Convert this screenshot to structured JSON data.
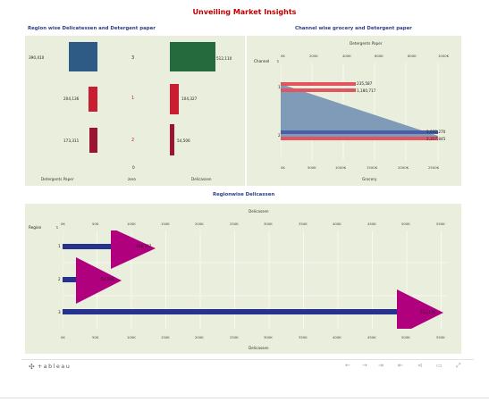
{
  "dashboard": {
    "title": "Unveiling Market Insights"
  },
  "region_chart": {
    "title": "Region wise Delicatessen and Detergent paper",
    "col_headers": [
      "Detergents Paper",
      "zero",
      "Delicassen"
    ],
    "rows": [
      {
        "region": "3",
        "detergents": "390,410",
        "delicassen": "512,110"
      },
      {
        "region": "1",
        "detergents": "204,136",
        "delicassen": "104,327"
      },
      {
        "region": "2",
        "detergents": "173,311",
        "delicassen": "54,506"
      }
    ],
    "zero_value": "0",
    "colors": {
      "blue": "#2e5a86",
      "green": "#246a3c",
      "red": "#c91d31",
      "darkred": "#9b1432",
      "region_red": "#d0202a"
    }
  },
  "channel_chart": {
    "title": "Channel wise grocery and Detergent paper",
    "top_axis_title": "Detergents Paper",
    "top_ticks": [
      "0K",
      "200K",
      "400K",
      "600K",
      "800K",
      "1000K"
    ],
    "bottom_axis_title": "Grocery",
    "bottom_ticks": [
      "0K",
      "500K",
      "1000K",
      "1500K",
      "2000K",
      "2500K"
    ],
    "row_header": "Channel",
    "sort_icon": "sort-icon",
    "rows": [
      {
        "label": "1",
        "detergents": "235,587",
        "grocery": "1,180,717"
      },
      {
        "label": "2",
        "detergents": "1,032,270",
        "grocery": "2,317,845"
      }
    ],
    "colors": {
      "area": "#7f9bb8",
      "bar": "#e05560",
      "line": "#4a5fa8"
    }
  },
  "deli_chart": {
    "title": "Regionwise Delicassen",
    "axis_title": "Delicassen",
    "row_header": "Region",
    "sort_icon": "sort-icon",
    "ticks": [
      "0K",
      "50K",
      "100K",
      "150K",
      "200K",
      "250K",
      "300K",
      "350K",
      "400K",
      "450K",
      "500K",
      "550K"
    ],
    "rows": [
      {
        "label": "1",
        "value": "104,327"
      },
      {
        "label": "2",
        "value": "54,506"
      },
      {
        "label": "3",
        "value": "512,110"
      }
    ],
    "colors": {
      "bar": "#27318e",
      "triangle": "#b0007e"
    }
  },
  "footer": {
    "brand": "+ableau",
    "brand_icon": "tableau-logo-icon",
    "nav_icons": [
      "undo-icon",
      "redo-icon",
      "revert-icon",
      "pause-icon",
      "share-icon",
      "comment-icon",
      "fullscreen-icon"
    ]
  },
  "chart_data": [
    {
      "type": "bar",
      "title": "Region wise Delicatessen and Detergent paper",
      "categories": [
        "3",
        "1",
        "2"
      ],
      "series": [
        {
          "name": "Detergents Paper",
          "values": [
            390410,
            204136,
            173311
          ]
        },
        {
          "name": "zero",
          "values": [
            0,
            0,
            0
          ]
        },
        {
          "name": "Delicassen",
          "values": [
            512110,
            104327,
            54506
          ]
        }
      ]
    },
    {
      "type": "area",
      "title": "Channel wise grocery and Detergent paper",
      "categories": [
        "1",
        "2"
      ],
      "series": [
        {
          "name": "Detergents Paper",
          "values": [
            235587,
            1032270
          ]
        },
        {
          "name": "Grocery",
          "values": [
            1180717,
            2317845
          ]
        }
      ],
      "xlim_detergents": [
        0,
        1000000
      ],
      "xlim_grocery": [
        0,
        2500000
      ]
    },
    {
      "type": "bar",
      "title": "Regionwise Delicassen",
      "categories": [
        "1",
        "2",
        "3"
      ],
      "values": [
        104327,
        54506,
        512110
      ],
      "xlabel": "Delicassen",
      "xlim": [
        0,
        550000
      ]
    }
  ]
}
